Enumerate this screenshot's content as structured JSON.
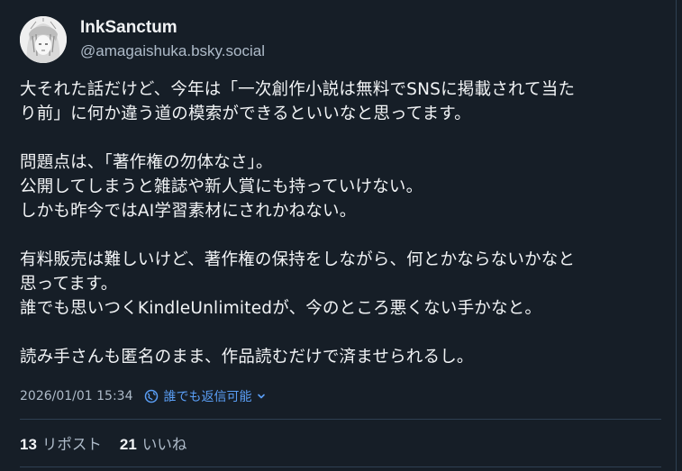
{
  "author": {
    "display_name": "InkSanctum",
    "handle": "@amagaishuka.bsky.social",
    "avatar_icon": "avatar-illustration"
  },
  "post": {
    "lines": [
      "大それた話だけど、今年は「一次創作小説は無料でSNSに掲載されて当た",
      "り前」に何か違う道の模索ができるといいなと思ってます。",
      "",
      "問題点は、「著作権の勿体なさ」。",
      "公開してしまうと雑誌や新人賞にも持っていけない。",
      "しかも昨今ではAI学習素材にされかねない。",
      "",
      "有料販売は難しいけど、著作権の保持をしながら、何とかならないかなと",
      "思ってます。",
      "誰でも思いつくKindleUnlimitedが、今のところ悪くない手かなと。",
      "",
      "読み手さんも匿名のまま、作品読むだけで済ませられるし。"
    ]
  },
  "meta": {
    "timestamp": "2026/01/01 15:34",
    "reply_setting": "誰でも返信可能",
    "reply_icon": "globe-icon",
    "chevron_icon": "chevron-down-icon"
  },
  "stats": {
    "reposts_count": "13",
    "reposts_label": "リポスト",
    "likes_count": "21",
    "likes_label": "いいね"
  },
  "colors": {
    "background": "#161e27",
    "text": "#f1f3f5",
    "muted": "#aebbc9",
    "accent": "#5a9ef5",
    "divider": "#2e4052"
  }
}
